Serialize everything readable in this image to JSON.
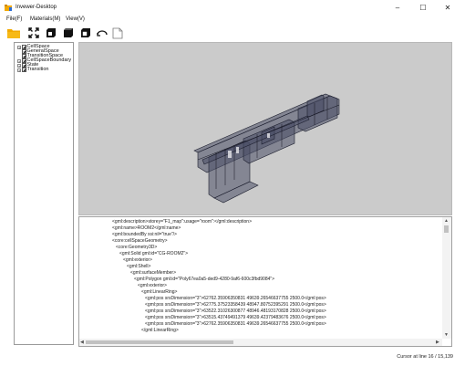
{
  "window": {
    "title": "Invewer-Desktop",
    "min_glyph": "–",
    "max_glyph": "☐",
    "close_glyph": "✕"
  },
  "menu": {
    "items": [
      "File(F)",
      "Materials(M)",
      "View(V)"
    ]
  },
  "toolbar": {
    "buttons": [
      "open-folder-icon",
      "fit-view-icon",
      "cube-outline-icon",
      "cube-solid-icon",
      "cube-split-icon",
      "rotate-view-icon",
      "blank-page-icon"
    ],
    "folder_color": "#f2a900"
  },
  "tree": {
    "items": [
      {
        "label": "CellSpace",
        "expandable": true
      },
      {
        "label": "GeneralSpace",
        "expandable": false
      },
      {
        "label": "TransitionSpace",
        "expandable": false
      },
      {
        "label": "CellSpaceBoundary",
        "expandable": true
      },
      {
        "label": "State",
        "expandable": true
      },
      {
        "label": "Transition",
        "expandable": true
      }
    ]
  },
  "viewport": {
    "background": "#cbcbcb",
    "model_color": "#4a4e66"
  },
  "code": {
    "lines": [
      "<gml:description>storey=\"F1_map\":usage=\"room\":</gml:description>",
      "<gml:name>ROOM2</gml:name>",
      "<gml:boundedBy xsi:nil=\"true\"/>",
      "<core:cellSpaceGeometry>",
      "<core:Geometry3D>",
      "<gml:Solid gml:id=\"CG-ROOM2\">",
      "<gml:exterior>",
      "<gml:Shell>",
      "<gml:surfaceMember>",
      "<gml:Polygon gml:id=\"Poly67ea0a5-ded9-4280-9af6-600c3fbd9084\">",
      "<gml:exterior>",
      "<gml:LinearRing>",
      "<gml:pos srsDimension=\"3\">62762.35906350831 49639.26546637755 2500.0</gml:pos>",
      "<gml:pos srsDimension=\"3\">62775.37523358439 48947.80752395291 2500.0</gml:pos>",
      "<gml:pos srsDimension=\"3\">63522.31026300877 48946.48193170828 2500.0</gml:pos>",
      "<gml:pos srsDimension=\"3\">63515.43749491379 49639.42379483676 2500.0</gml:pos>",
      "<gml:pos srsDimension=\"3\">62762.35906350831 49639.26546637755 2500.0</gml:pos>",
      "</gml:LinearRing>"
    ],
    "indents": [
      0,
      0,
      0,
      0,
      1,
      2,
      3,
      4,
      5,
      6,
      7,
      8,
      9,
      9,
      9,
      9,
      9,
      8
    ]
  },
  "status": {
    "text": "Cursor at line 16 / 15,139"
  }
}
